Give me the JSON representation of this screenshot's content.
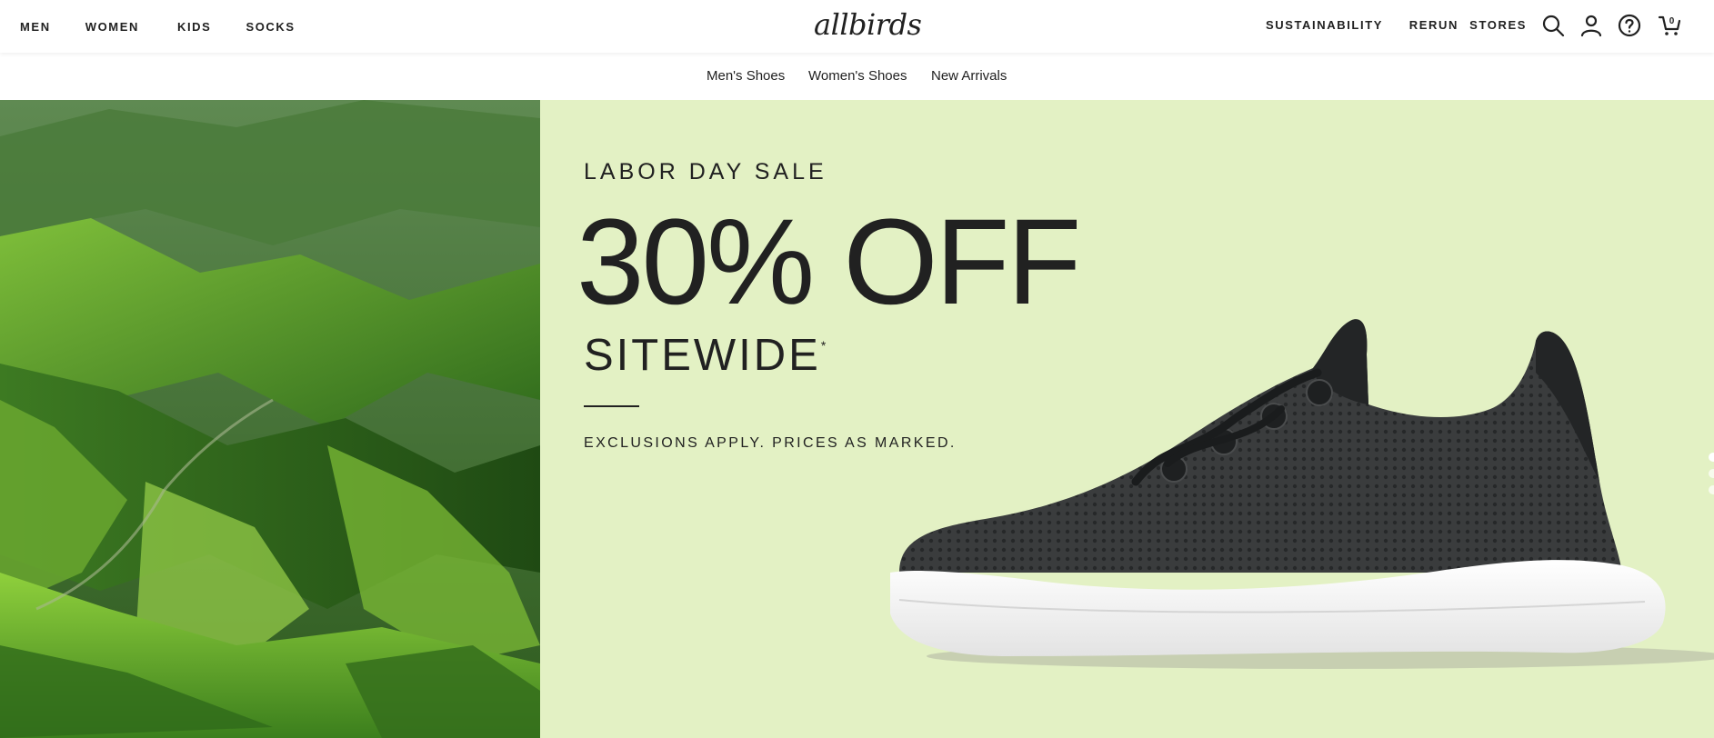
{
  "nav": {
    "left": [
      "MEN",
      "WOMEN",
      "KIDS",
      "SOCKS"
    ],
    "logo": "allbirds",
    "right": [
      "SUSTAINABILITY",
      "RERUN",
      "STORES"
    ],
    "cart_count": "0"
  },
  "subnav": [
    "Men's Shoes",
    "Women's Shoes",
    "New Arrivals"
  ],
  "hero": {
    "eyebrow": "LABOR DAY SALE",
    "headline": "30% OFF",
    "subheadline": "SITEWIDE",
    "footnote_mark": "*",
    "disclaimer": "EXCLUSIONS APPLY. PRICES AS MARKED.",
    "background_color": "#e3f1c4"
  },
  "icons": [
    "search-icon",
    "account-icon",
    "help-icon",
    "cart-icon"
  ]
}
